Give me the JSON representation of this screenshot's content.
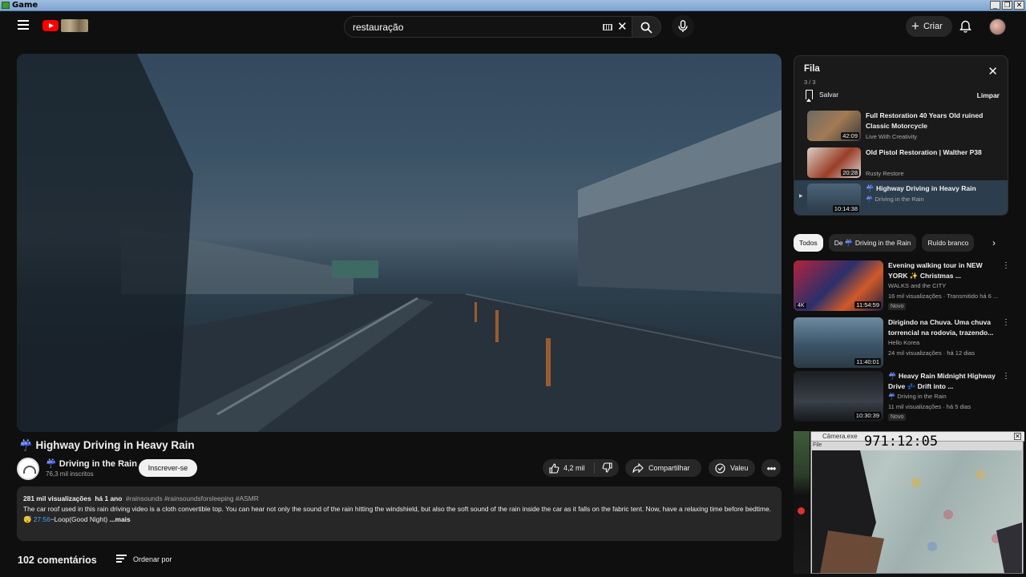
{
  "window": {
    "title": "Game",
    "controls": [
      "_",
      "❐",
      "✕"
    ]
  },
  "header": {
    "search_value": "restauração",
    "create_label": "Criar"
  },
  "video": {
    "title": "☔ Highway Driving in Heavy Rain",
    "channel_name": "☔ Driving in the Rain",
    "subscribers": "76,3 mil inscritos",
    "subscribe_label": "Inscrever-se",
    "likes": "4,2 mil",
    "share_label": "Compartilhar",
    "thanks_label": "Valeu",
    "more_label": "•••"
  },
  "description": {
    "views": "281 mil visualizações",
    "age": "há 1 ano",
    "tags": "#rainsounds #rainsoundsforsleeping #ASMR",
    "text": "The car roof used in this rain driving video is a cloth convertible top. You can hear not only the sound of the rain hitting the windshield, but also the soft sound of the rain inside the car as it falls on the fabric tent. Now, have a relaxing time before bedtime.",
    "chapter_emoji": "😴",
    "chapter_time": "27:56",
    "chapter_label": "~Loop(Good Night)",
    "more_label": "...mais"
  },
  "comments": {
    "count_label": "102 comentários",
    "sort_label": "Ordenar por"
  },
  "queue": {
    "title": "Fila",
    "position": "3 / 3",
    "save_label": "Salvar",
    "clear_label": "Limpar",
    "items": [
      {
        "title": "Full Restoration 40 Years Old ruined Classic Motorcycle",
        "channel": "Live With Creativity",
        "duration": "42:09",
        "active": false
      },
      {
        "title": "Old Pistol Restoration | Walther P38",
        "channel": "Rusty Restore",
        "duration": "20:28",
        "active": false
      },
      {
        "title": "☔ Highway Driving in Heavy Rain",
        "channel": "☔ Driving in the Rain",
        "duration": "10:14:38",
        "active": true
      }
    ]
  },
  "chips": [
    "Todos",
    "De ☔ Driving in the Rain",
    "Ruído branco"
  ],
  "recommendations": [
    {
      "title": "Evening walking tour in NEW YORK ✨ Christmas ...",
      "channel": "WALKS and the CITY",
      "meta": "16 mil visualizações · Transmitido há 6 ...",
      "duration": "11:54:59",
      "badge": "Novo",
      "thumb_overlay": "4K"
    },
    {
      "title": "Dirigindo na Chuva. Uma chuva torrencial na rodovia, trazendo...",
      "channel": "Hello Korea",
      "meta": "24 mil visualizações · há 12 dias",
      "duration": "11:40:01",
      "badge": ""
    },
    {
      "title": "☔ Heavy Rain Midnight Highway Drive 💤 Drift into ...",
      "channel": "☔ Driving in the Rain",
      "meta": "11 mil visualizações · há 5 dias",
      "duration": "10:30:39",
      "badge": "Novo"
    }
  ],
  "overlay": {
    "titlebar": "Câmera.exe",
    "clock": "971:12:05",
    "menu": "File"
  },
  "colors": {
    "background": "#0f0f0f",
    "chip": "#272727",
    "accent": "#ff0000",
    "link": "#3ea6ff"
  }
}
